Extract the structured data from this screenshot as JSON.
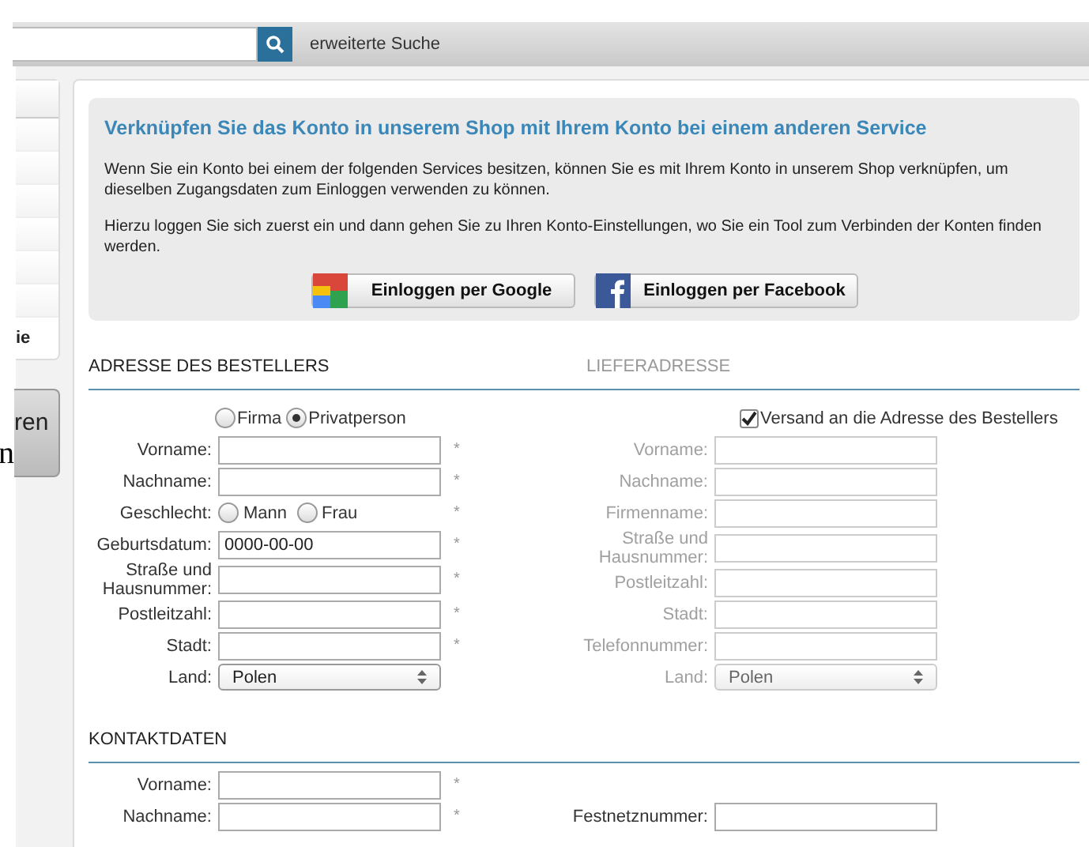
{
  "search": {
    "link": "erweiterte Suche"
  },
  "sidebar": {
    "items": [
      "ie"
    ],
    "button": "ren",
    "overflow_text": "n"
  },
  "info": {
    "title": "Verknüpfen Sie das Konto in unserem Shop mit Ihrem Konto bei einem anderen Service",
    "paragraphs": [
      "Wenn Sie ein Konto bei einem der folgenden Services besitzen, können Sie es mit Ihrem Konto in unserem Shop verknüpfen, um dieselben Zugangsdaten zum Einloggen verwenden zu können.",
      "Hierzu loggen Sie sich zuerst ein und dann gehen Sie zu Ihren Konto-Einstellungen, wo Sie ein Tool zum Verbinden der Konten finden werden."
    ],
    "buttons": [
      {
        "kind": "google",
        "label": "Einloggen per Google"
      },
      {
        "kind": "facebook",
        "label": "Einloggen per Facebook"
      }
    ]
  },
  "billing": {
    "title": "ADRESSE DES BESTELLERS",
    "customer_types": [
      {
        "label": "Firma",
        "selected": false
      },
      {
        "label": "Privatperson",
        "selected": true
      }
    ],
    "fields": [
      {
        "kind": "text",
        "label": "Vorname:",
        "mark": "*"
      },
      {
        "kind": "text",
        "label": "Nachname:",
        "mark": "*"
      },
      {
        "kind": "radio",
        "label": "Geschlecht:",
        "mark": "*",
        "options": [
          {
            "label": "Mann",
            "selected": false
          },
          {
            "label": "Frau",
            "selected": false
          }
        ]
      },
      {
        "kind": "text",
        "label": "Geburtsdatum:",
        "value": "0000-00-00",
        "mark": "*"
      },
      {
        "kind": "text",
        "label": "Straße und Hausnummer:",
        "mark": "*"
      },
      {
        "kind": "text",
        "label": "Postleitzahl:",
        "mark": "*"
      },
      {
        "kind": "text",
        "label": "Stadt:",
        "mark": "*"
      },
      {
        "kind": "select",
        "label": "Land:",
        "value": "Polen"
      }
    ]
  },
  "shipping": {
    "title": "LIEFERADRESSE",
    "disabled": true,
    "same_as_billing": {
      "label": "Versand an die Adresse des Bestellers",
      "checked": true
    },
    "fields": [
      {
        "kind": "text",
        "label": "Vorname:"
      },
      {
        "kind": "text",
        "label": "Nachname:"
      },
      {
        "kind": "text",
        "label": "Firmenname:"
      },
      {
        "kind": "text",
        "label": "Straße und Hausnummer:"
      },
      {
        "kind": "text",
        "label": "Postleitzahl:"
      },
      {
        "kind": "text",
        "label": "Stadt:"
      },
      {
        "kind": "text",
        "label": "Telefonnummer:"
      },
      {
        "kind": "select",
        "label": "Land:",
        "value": "Polen"
      }
    ]
  },
  "contact": {
    "title": "KONTAKTDATEN",
    "rows": [
      {
        "left": {
          "kind": "text",
          "label": "Vorname:",
          "mark": "*"
        }
      },
      {
        "left": {
          "kind": "text",
          "label": "Nachname:",
          "mark": "*"
        },
        "right": {
          "kind": "text",
          "label": "Festnetznummer:"
        }
      }
    ]
  }
}
